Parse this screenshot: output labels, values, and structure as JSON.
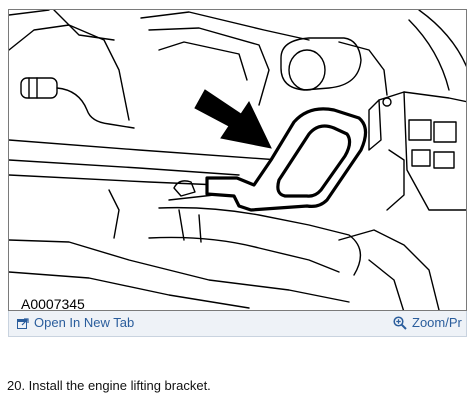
{
  "figure": {
    "id_label": "A0007345"
  },
  "toolbar": {
    "open_label": "Open In New Tab",
    "open_icon": "open-in-new-tab-icon",
    "zoom_label": "Zoom/Pr",
    "zoom_icon": "magnifier-plus-icon",
    "link_color": "#2a5d9c"
  },
  "step": {
    "text": "20. Install the engine lifting bracket."
  }
}
